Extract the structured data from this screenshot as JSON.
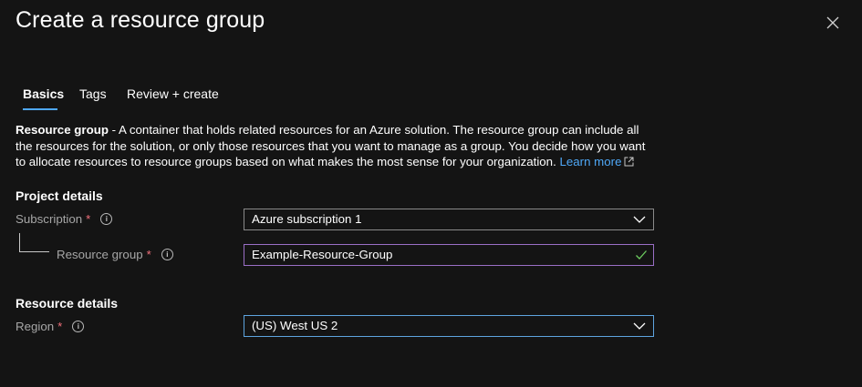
{
  "header": {
    "title": "Create a resource group"
  },
  "tabs": [
    {
      "label": "Basics"
    },
    {
      "label": "Tags"
    },
    {
      "label": "Review + create"
    }
  ],
  "description": {
    "bold": "Resource group",
    "text": " - A container that holds related resources for an Azure solution. The resource group can include all the resources for the solution, or only those resources that you want to manage as a group. You decide how you want to allocate resources to resource groups based on what makes the most sense for your organization. ",
    "link": "Learn more"
  },
  "project_details": {
    "heading": "Project details",
    "subscription": {
      "label": "Subscription",
      "required": "*",
      "value": "Azure subscription 1"
    },
    "resource_group": {
      "label": "Resource group",
      "required": "*",
      "value": "Example-Resource-Group"
    }
  },
  "resource_details": {
    "heading": "Resource details",
    "region": {
      "label": "Region",
      "required": "*",
      "value": "(US) West US 2"
    }
  },
  "colors": {
    "background": "#141414",
    "link": "#4fa8f7",
    "required": "#f1707b",
    "valid_check": "#6ccb5f",
    "focus_border": "#9a6fc6"
  },
  "icons": [
    "close-icon",
    "external-link-icon",
    "info-icon",
    "chevron-down-icon",
    "checkmark-icon"
  ]
}
